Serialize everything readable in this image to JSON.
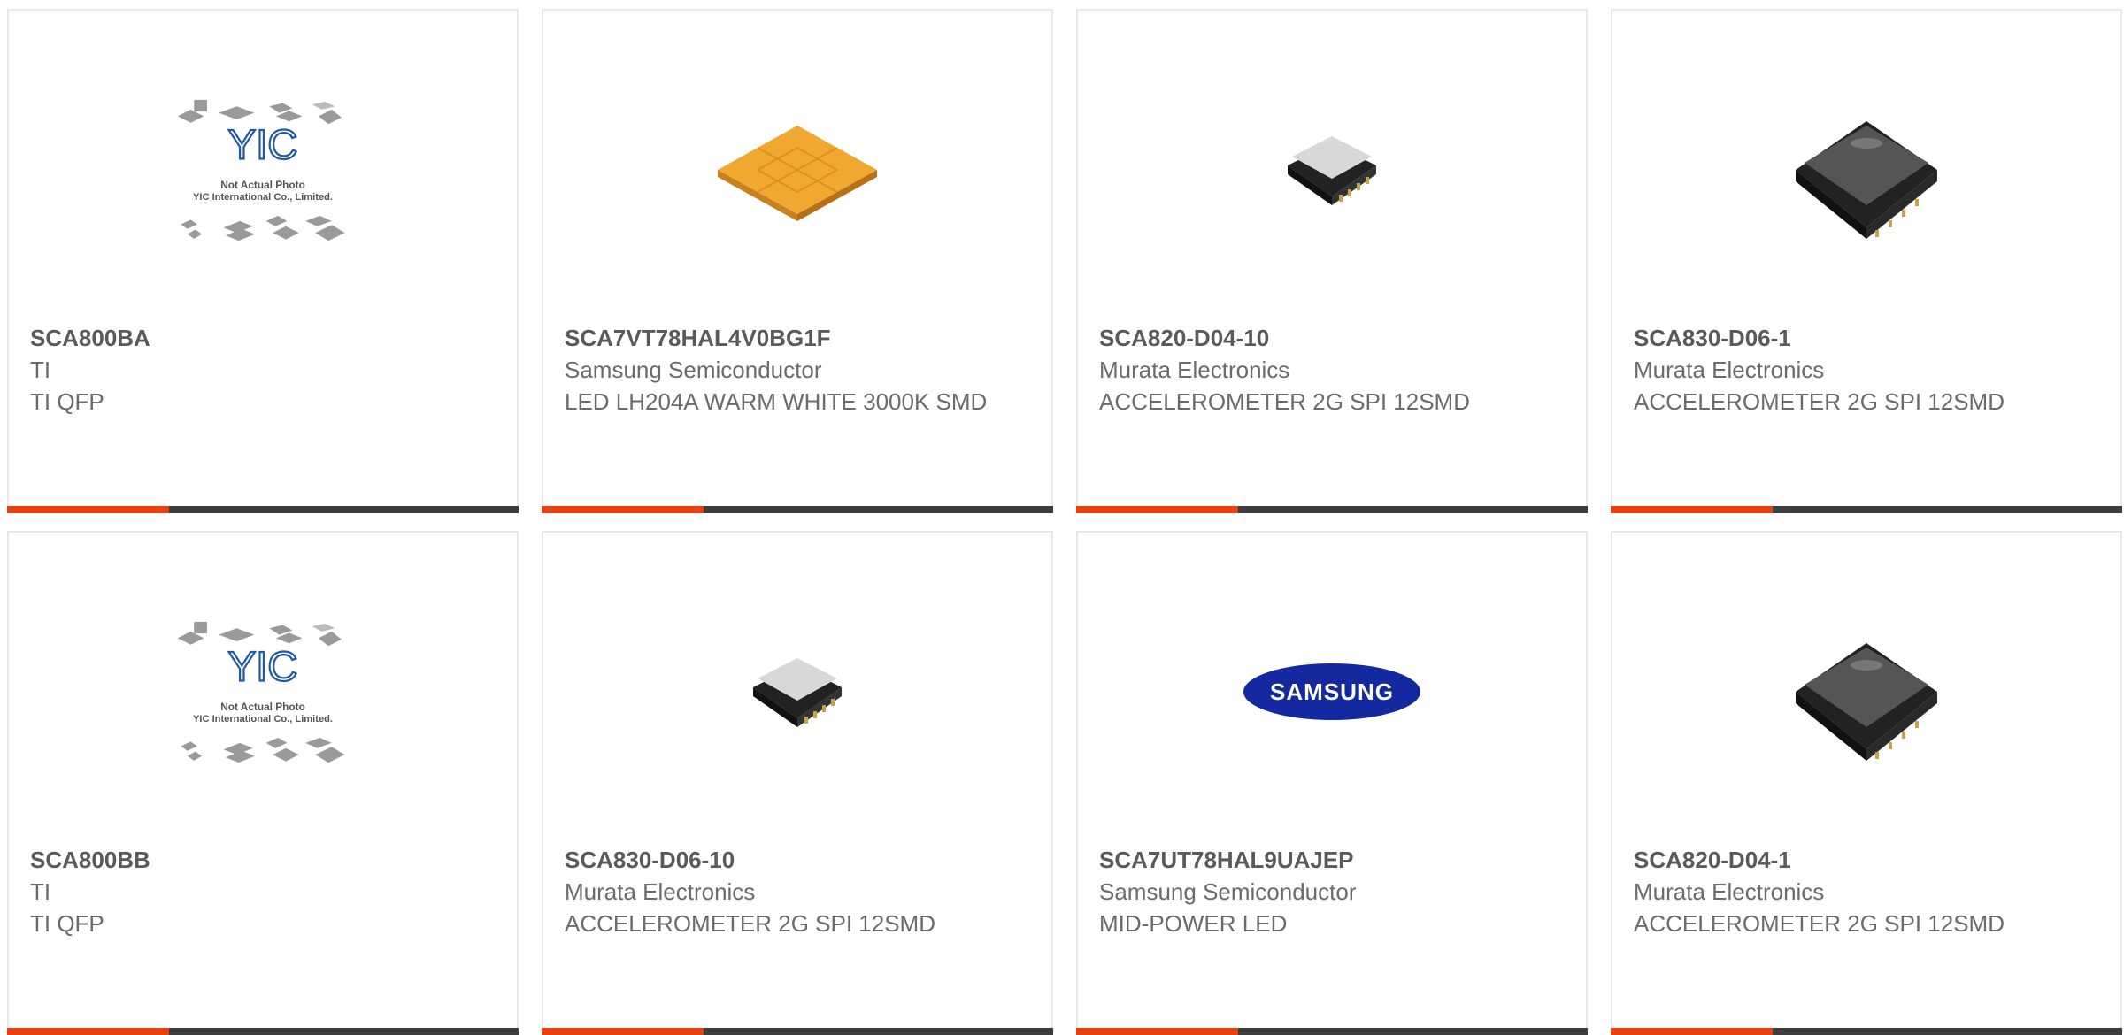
{
  "products": [
    {
      "part": "SCA800BA",
      "maker": "TI",
      "desc": "TI QFP",
      "image": "yic-placeholder",
      "placeholder_title": "Not Actual Photo",
      "placeholder_sub": "YIC International Co., Limited.",
      "placeholder_brand": "YIC"
    },
    {
      "part": "SCA7VT78HAL4V0BG1F",
      "maker": "Samsung Semiconductor",
      "desc": "LED LH204A WARM WHITE 3000K SMD",
      "image": "led-chip"
    },
    {
      "part": "SCA820-D04-10",
      "maker": "Murata Electronics",
      "desc": "ACCELEROMETER 2G SPI 12SMD",
      "image": "sensor-small"
    },
    {
      "part": "SCA830-D06-1",
      "maker": "Murata Electronics",
      "desc": "ACCELEROMETER 2G SPI 12SMD",
      "image": "sensor-large"
    },
    {
      "part": "SCA800BB",
      "maker": "TI",
      "desc": "TI QFP",
      "image": "yic-placeholder",
      "placeholder_title": "Not Actual Photo",
      "placeholder_sub": "YIC International Co., Limited.",
      "placeholder_brand": "YIC"
    },
    {
      "part": "SCA830-D06-10",
      "maker": "Murata Electronics",
      "desc": "ACCELEROMETER 2G SPI 12SMD",
      "image": "sensor-small"
    },
    {
      "part": "SCA7UT78HAL9UAJEP",
      "maker": "Samsung Semiconductor",
      "desc": "MID-POWER LED",
      "image": "samsung-logo",
      "logo_text": "SAMSUNG"
    },
    {
      "part": "SCA820-D04-1",
      "maker": "Murata Electronics",
      "desc": "ACCELEROMETER 2G SPI 12SMD",
      "image": "sensor-large"
    }
  ],
  "colors": {
    "accent": "#e8400f",
    "bar": "#3d3d3d",
    "text": "#6b6b6b",
    "samsung_blue": "#1428a0"
  }
}
